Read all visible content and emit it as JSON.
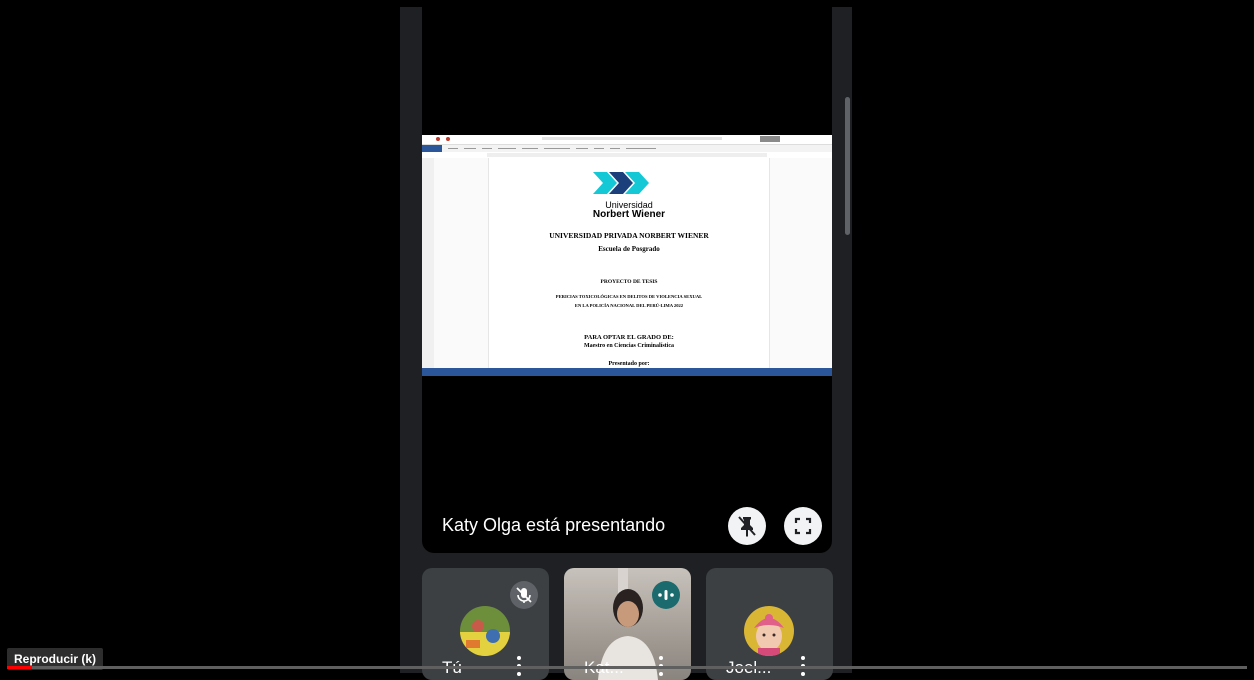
{
  "stage": {
    "caption": "Katy Olga está presentando"
  },
  "document": {
    "logo_line1": "Universidad",
    "logo_line2": "Norbert Wiener",
    "lines": [
      "UNIVERSIDAD PRIVADA NORBERT WIENER",
      "Escuela de Posgrado",
      "PROYECTO DE TESIS",
      "PERICIAS TOXICOLÓGICAS EN DELITOS DE VIOLENCIA SEXUAL",
      "EN LA POLICÍA NACIONAL DEL PERÚ-LIMA 2022",
      "PARA OPTAR EL GRADO DE:",
      "Maestro en Ciencias Criminalística",
      "Presentado por:"
    ],
    "brand_colors": [
      "#2b579a",
      "#14c8d6",
      "#1a3f7a"
    ]
  },
  "participants": [
    {
      "name": "Tú",
      "badge_icon": "mic-off-icon"
    },
    {
      "name": "Kat...",
      "badge_icon": "speaking-icon"
    },
    {
      "name": "Joel..."
    }
  ],
  "player": {
    "tooltip": "Reproducir (k)",
    "progress_fraction": 0.02
  },
  "colors": {
    "accent": "#1a73e8",
    "speaking": "#1a6a6e",
    "tile_bg": "#3c4043"
  }
}
